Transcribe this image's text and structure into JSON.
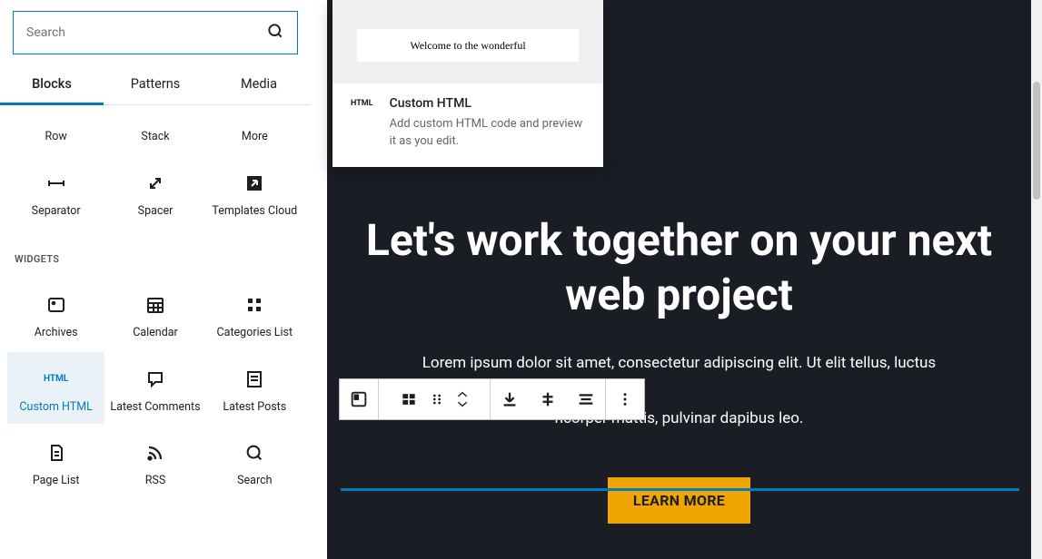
{
  "sidebar": {
    "search_placeholder": "Search",
    "tabs": {
      "blocks": "Blocks",
      "patterns": "Patterns",
      "media": "Media"
    },
    "design_items": [
      {
        "name": "row",
        "label": "Row"
      },
      {
        "name": "stack",
        "label": "Stack"
      },
      {
        "name": "more",
        "label": "More"
      },
      {
        "name": "separator",
        "label": "Separator"
      },
      {
        "name": "spacer",
        "label": "Spacer"
      },
      {
        "name": "templates-cloud",
        "label": "Templates Cloud"
      }
    ],
    "widgets_title": "WIDGETS",
    "widget_items": [
      {
        "name": "archives",
        "label": "Archives"
      },
      {
        "name": "calendar",
        "label": "Calendar"
      },
      {
        "name": "categories-list",
        "label": "Categories List"
      },
      {
        "name": "custom-html",
        "label": "Custom HTML",
        "selected": true
      },
      {
        "name": "latest-comments",
        "label": "Latest Comments"
      },
      {
        "name": "latest-posts",
        "label": "Latest Posts"
      },
      {
        "name": "page-list",
        "label": "Page List"
      },
      {
        "name": "rss",
        "label": "RSS"
      },
      {
        "name": "search",
        "label": "Search"
      }
    ]
  },
  "preview": {
    "sample_text": "Welcome to the wonderful",
    "badge": "HTML",
    "title": "Custom HTML",
    "desc": "Add custom HTML code and preview it as you edit."
  },
  "hero": {
    "heading": "Let's work together on your next web project",
    "para1": "Lorem ipsum dolor sit amet, consectetur adipiscing elit. Ut elit tellus, luctus",
    "para2": "ncorper mattis, pulvinar dapibus leo.",
    "cta": "LEARN MORE"
  }
}
